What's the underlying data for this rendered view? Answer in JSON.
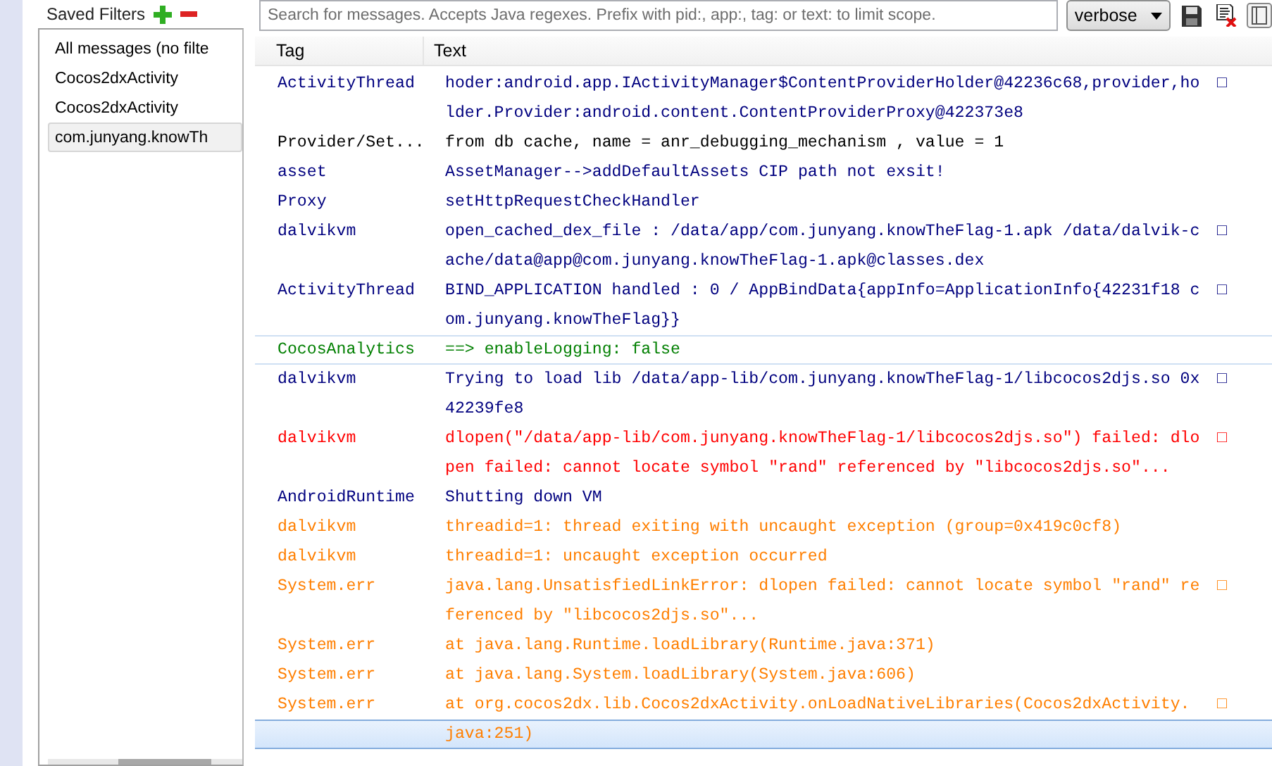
{
  "saved_filters": {
    "title": "Saved Filters",
    "items": [
      {
        "label": "All messages (no filte",
        "selected": false
      },
      {
        "label": "Cocos2dxActivity",
        "selected": false
      },
      {
        "label": "Cocos2dxActivity",
        "selected": false
      },
      {
        "label": "com.junyang.knowTh",
        "selected": true
      }
    ]
  },
  "toolbar": {
    "search": {
      "placeholder": "Search for messages. Accepts Java regexes. Prefix with pid:, app:, tag: or text: to limit scope."
    },
    "log_level": "verbose"
  },
  "table": {
    "columns": [
      "Tag",
      "Text"
    ],
    "rows": [
      {
        "tag": "ActivityThread",
        "text": "hoder:android.app.IActivityManager$ContentProviderHolder@42236c68,provider,ho",
        "wrap_mark": "□",
        "color": "#00007f",
        "selected": false,
        "highlighted": false
      },
      {
        "text": "lder.Provider:android.content.ContentProviderProxy@422373e8",
        "color": "#00007f",
        "selected": false,
        "highlighted": false
      },
      {
        "tag": "Provider/Set...",
        "text": "from db cache, name = anr_debugging_mechanism , value = 1",
        "color": "#000000",
        "selected": false,
        "highlighted": false
      },
      {
        "tag": "asset",
        "text": "AssetManager-->addDefaultAssets CIP path not exsit!",
        "color": "#00007f",
        "selected": false,
        "highlighted": false
      },
      {
        "tag": "Proxy",
        "text": "setHttpRequestCheckHandler",
        "color": "#00007f",
        "selected": false,
        "highlighted": false
      },
      {
        "tag": "dalvikvm",
        "text": "open_cached_dex_file : /data/app/com.junyang.knowTheFlag-1.apk /data/dalvik-c",
        "wrap_mark": "□",
        "color": "#00007f",
        "selected": false,
        "highlighted": false
      },
      {
        "text": "ache/data@app@com.junyang.knowTheFlag-1.apk@classes.dex",
        "color": "#00007f",
        "selected": false,
        "highlighted": false
      },
      {
        "tag": "ActivityThread",
        "text": "BIND_APPLICATION handled : 0 / AppBindData{appInfo=ApplicationInfo{42231f18 c",
        "wrap_mark": "□",
        "color": "#00007f",
        "selected": false,
        "highlighted": false
      },
      {
        "text": "om.junyang.knowTheFlag}}",
        "color": "#00007f",
        "selected": false,
        "highlighted": false
      },
      {
        "tag": "CocosAnalytics",
        "text": "==> enableLogging: false",
        "color": "#007f00",
        "selected": false,
        "highlighted": true
      },
      {
        "tag": "dalvikvm",
        "text": "Trying to load lib /data/app-lib/com.junyang.knowTheFlag-1/libcocos2djs.so 0x",
        "wrap_mark": "□",
        "color": "#00007f",
        "selected": false,
        "highlighted": false
      },
      {
        "text": "42239fe8",
        "color": "#00007f",
        "selected": false,
        "highlighted": false
      },
      {
        "tag": "dalvikvm",
        "text": "dlopen(\"/data/app-lib/com.junyang.knowTheFlag-1/libcocos2djs.so\") failed: dlo",
        "wrap_mark": "□",
        "color": "#ff0000",
        "selected": false,
        "highlighted": false
      },
      {
        "text": "pen failed: cannot locate symbol \"rand\" referenced by \"libcocos2djs.so\"...",
        "color": "#ff0000",
        "selected": false,
        "highlighted": false
      },
      {
        "tag": "AndroidRuntime",
        "text": "Shutting down VM",
        "color": "#00007f",
        "selected": false,
        "highlighted": false
      },
      {
        "tag": "dalvikvm",
        "text": "threadid=1: thread exiting with uncaught exception (group=0x419c0cf8)",
        "color": "#ff7f00",
        "selected": false,
        "highlighted": false
      },
      {
        "tag": "dalvikvm",
        "text": "threadid=1: uncaught exception occurred",
        "color": "#ff7f00",
        "selected": false,
        "highlighted": false
      },
      {
        "tag": "System.err",
        "text": "java.lang.UnsatisfiedLinkError: dlopen failed: cannot locate symbol \"rand\" re",
        "wrap_mark": "□",
        "color": "#ff7f00",
        "selected": false,
        "highlighted": false
      },
      {
        "text": "ferenced by \"libcocos2djs.so\"...",
        "color": "#ff7f00",
        "selected": false,
        "highlighted": false
      },
      {
        "tag": "System.err",
        "text": "at java.lang.Runtime.loadLibrary(Runtime.java:371)",
        "color": "#ff7f00",
        "selected": false,
        "highlighted": false
      },
      {
        "tag": "System.err",
        "text": "at java.lang.System.loadLibrary(System.java:606)",
        "color": "#ff7f00",
        "selected": false,
        "highlighted": false
      },
      {
        "tag": "System.err",
        "text": "at org.cocos2dx.lib.Cocos2dxActivity.onLoadNativeLibraries(Cocos2dxActivity.",
        "wrap_mark": "□",
        "color": "#ff7f00",
        "selected": false,
        "highlighted": false
      },
      {
        "text": "java:251)",
        "color": "#ff7f00",
        "selected": true,
        "highlighted": false
      }
    ]
  }
}
